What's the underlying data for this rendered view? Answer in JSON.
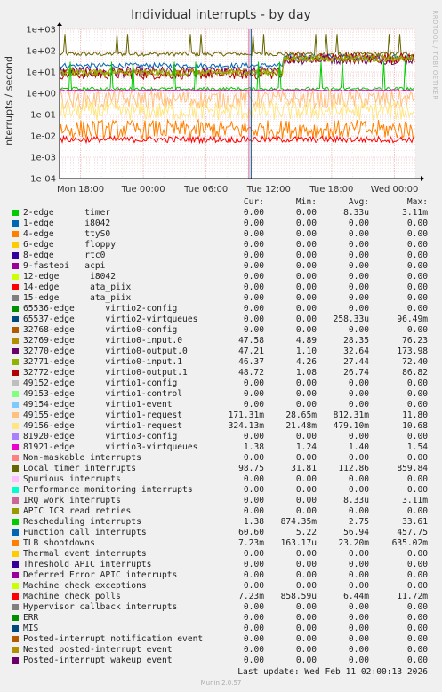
{
  "title": "Individual interrupts - by day",
  "ylabel": "interrupts / second",
  "side_label": "RRDTOOL / TOBI OETIKER",
  "columns": [
    "Cur:",
    "Min:",
    "Avg:",
    "Max:"
  ],
  "rows": [
    {
      "label": "2-edge      timer",
      "color": "#00cc00",
      "cur": "0.00",
      "min": "0.00",
      "avg": "8.33u",
      "max": "3.11m"
    },
    {
      "label": "1-edge      i8042",
      "color": "#0066b3",
      "cur": "0.00",
      "min": "0.00",
      "avg": "0.00",
      "max": "0.00"
    },
    {
      "label": "4-edge      ttyS0",
      "color": "#ff8000",
      "cur": "0.00",
      "min": "0.00",
      "avg": "0.00",
      "max": "0.00"
    },
    {
      "label": "6-edge      floppy",
      "color": "#ffcc00",
      "cur": "0.00",
      "min": "0.00",
      "avg": "0.00",
      "max": "0.00"
    },
    {
      "label": "8-edge      rtc0",
      "color": "#330099",
      "cur": "0.00",
      "min": "0.00",
      "avg": "0.00",
      "max": "0.00"
    },
    {
      "label": "9-fasteoi   acpi",
      "color": "#990099",
      "cur": "0.00",
      "min": "0.00",
      "avg": "0.00",
      "max": "0.00"
    },
    {
      "label": "12-edge      i8042",
      "color": "#ccff00",
      "cur": "0.00",
      "min": "0.00",
      "avg": "0.00",
      "max": "0.00"
    },
    {
      "label": "14-edge      ata_piix",
      "color": "#ff0000",
      "cur": "0.00",
      "min": "0.00",
      "avg": "0.00",
      "max": "0.00"
    },
    {
      "label": "15-edge      ata_piix",
      "color": "#808080",
      "cur": "0.00",
      "min": "0.00",
      "avg": "0.00",
      "max": "0.00"
    },
    {
      "label": "65536-edge      virtio2-config",
      "color": "#008f00",
      "cur": "0.00",
      "min": "0.00",
      "avg": "0.00",
      "max": "0.00"
    },
    {
      "label": "65537-edge      virtio2-virtqueues",
      "color": "#00487d",
      "cur": "0.00",
      "min": "0.00",
      "avg": "258.33u",
      "max": "96.49m"
    },
    {
      "label": "32768-edge      virtio0-config",
      "color": "#b35a00",
      "cur": "0.00",
      "min": "0.00",
      "avg": "0.00",
      "max": "0.00"
    },
    {
      "label": "32769-edge      virtio0-input.0",
      "color": "#b38f00",
      "cur": "47.58",
      "min": "4.89",
      "avg": "28.35",
      "max": "76.23"
    },
    {
      "label": "32770-edge      virtio0-output.0",
      "color": "#6b006b",
      "cur": "47.21",
      "min": "1.10",
      "avg": "32.64",
      "max": "173.98"
    },
    {
      "label": "32771-edge      virtio0-input.1",
      "color": "#8fb300",
      "cur": "46.37",
      "min": "4.26",
      "avg": "27.44",
      "max": "72.40"
    },
    {
      "label": "32772-edge      virtio0-output.1",
      "color": "#b30000",
      "cur": "48.72",
      "min": "1.08",
      "avg": "26.74",
      "max": "86.82"
    },
    {
      "label": "49152-edge      virtio1-config",
      "color": "#bebebe",
      "cur": "0.00",
      "min": "0.00",
      "avg": "0.00",
      "max": "0.00"
    },
    {
      "label": "49153-edge      virtio1-control",
      "color": "#80ff80",
      "cur": "0.00",
      "min": "0.00",
      "avg": "0.00",
      "max": "0.00"
    },
    {
      "label": "49154-edge      virtio1-event",
      "color": "#80c9ff",
      "cur": "0.00",
      "min": "0.00",
      "avg": "0.00",
      "max": "0.00"
    },
    {
      "label": "49155-edge      virtio1-request",
      "color": "#ffc080",
      "cur": "171.31m",
      "min": "28.65m",
      "avg": "812.31m",
      "max": "11.80"
    },
    {
      "label": "49156-edge      virtio1-request",
      "color": "#ffe680",
      "cur": "324.13m",
      "min": "21.48m",
      "avg": "479.10m",
      "max": "10.68"
    },
    {
      "label": "81920-edge      virtio3-config",
      "color": "#aa80ff",
      "cur": "0.00",
      "min": "0.00",
      "avg": "0.00",
      "max": "0.00"
    },
    {
      "label": "81921-edge      virtio3-virtqueues",
      "color": "#ee00cc",
      "cur": "1.38",
      "min": "1.24",
      "avg": "1.40",
      "max": "1.54"
    },
    {
      "label": "Non-maskable interrupts",
      "color": "#ff8080",
      "cur": "0.00",
      "min": "0.00",
      "avg": "0.00",
      "max": "0.00"
    },
    {
      "label": "Local timer interrupts",
      "color": "#666600",
      "cur": "98.75",
      "min": "31.81",
      "avg": "112.86",
      "max": "859.84"
    },
    {
      "label": "Spurious interrupts",
      "color": "#ffbfff",
      "cur": "0.00",
      "min": "0.00",
      "avg": "0.00",
      "max": "0.00"
    },
    {
      "label": "Performance monitoring interrupts",
      "color": "#00ffcc",
      "cur": "0.00",
      "min": "0.00",
      "avg": "0.00",
      "max": "0.00"
    },
    {
      "label": "IRQ work interrupts",
      "color": "#cc6699",
      "cur": "0.00",
      "min": "0.00",
      "avg": "8.33u",
      "max": "3.11m"
    },
    {
      "label": "APIC ICR read retries",
      "color": "#999900",
      "cur": "0.00",
      "min": "0.00",
      "avg": "0.00",
      "max": "0.00"
    },
    {
      "label": "Rescheduling interrupts",
      "color": "#00cc00",
      "cur": "1.38",
      "min": "874.35m",
      "avg": "2.75",
      "max": "33.61"
    },
    {
      "label": "Function call interrupts",
      "color": "#0066b3",
      "cur": "60.60",
      "min": "5.22",
      "avg": "56.94",
      "max": "457.75"
    },
    {
      "label": "TLB shootdowns",
      "color": "#ff8000",
      "cur": "7.23m",
      "min": "163.17u",
      "avg": "23.20m",
      "max": "635.02m"
    },
    {
      "label": "Thermal event interrupts",
      "color": "#ffcc00",
      "cur": "0.00",
      "min": "0.00",
      "avg": "0.00",
      "max": "0.00"
    },
    {
      "label": "Threshold APIC interrupts",
      "color": "#330099",
      "cur": "0.00",
      "min": "0.00",
      "avg": "0.00",
      "max": "0.00"
    },
    {
      "label": "Deferred Error APIC interrupts",
      "color": "#990099",
      "cur": "0.00",
      "min": "0.00",
      "avg": "0.00",
      "max": "0.00"
    },
    {
      "label": "Machine check exceptions",
      "color": "#ccff00",
      "cur": "0.00",
      "min": "0.00",
      "avg": "0.00",
      "max": "0.00"
    },
    {
      "label": "Machine check polls",
      "color": "#ff0000",
      "cur": "7.23m",
      "min": "858.59u",
      "avg": "6.44m",
      "max": "11.72m"
    },
    {
      "label": "Hypervisor callback interrupts",
      "color": "#808080",
      "cur": "0.00",
      "min": "0.00",
      "avg": "0.00",
      "max": "0.00"
    },
    {
      "label": "ERR",
      "color": "#008f00",
      "cur": "0.00",
      "min": "0.00",
      "avg": "0.00",
      "max": "0.00"
    },
    {
      "label": "MIS",
      "color": "#00487d",
      "cur": "0.00",
      "min": "0.00",
      "avg": "0.00",
      "max": "0.00"
    },
    {
      "label": "Posted-interrupt notification event",
      "color": "#b35a00",
      "cur": "0.00",
      "min": "0.00",
      "avg": "0.00",
      "max": "0.00"
    },
    {
      "label": "Nested posted-interrupt event",
      "color": "#b38f00",
      "cur": "0.00",
      "min": "0.00",
      "avg": "0.00",
      "max": "0.00"
    },
    {
      "label": "Posted-interrupt wakeup event",
      "color": "#6b006b",
      "cur": "0.00",
      "min": "0.00",
      "avg": "0.00",
      "max": "0.00"
    }
  ],
  "last_update": "Last update: Wed Feb 11 02:00:13 2026",
  "footer": "Munin 2.0.57",
  "chart_data": {
    "type": "line",
    "title": "Individual interrupts - by day",
    "ylabel": "interrupts / second",
    "yscale": "log",
    "ylim": [
      0.0001,
      1000
    ],
    "yticks": [
      "1e-04",
      "1e-03",
      "1e-02",
      "1e-01",
      "1e+00",
      "1e+01",
      "1e+02",
      "1e+03"
    ],
    "xticks": [
      "Mon 18:00",
      "Tue 00:00",
      "Tue 06:00",
      "Tue 12:00",
      "Tue 18:00",
      "Wed 00:00"
    ],
    "xlim_hours": [
      -2,
      32
    ],
    "grid": true,
    "series": [
      {
        "name": "Local timer interrupts",
        "color": "#666600",
        "base": 70,
        "spike": 600,
        "spike_every_h": 1,
        "noise": 0.1
      },
      {
        "name": "Function call interrupts",
        "color": "#0066b3",
        "base_before": 20,
        "base_after": 50,
        "switch_h": 19.4,
        "noise": 0.12
      },
      {
        "name": "32770-edge      virtio0-output.0",
        "color": "#6b006b",
        "base_before": 10,
        "base_after": 40,
        "switch_h": 19.4,
        "noise": 0.25
      },
      {
        "name": "32772-edge      virtio0-output.1",
        "color": "#b30000",
        "base_before": 8,
        "base_after": 45,
        "switch_h": 19.4,
        "noise": 0.25
      },
      {
        "name": "32769-edge      virtio0-input.0",
        "color": "#b38f00",
        "base_before": 10,
        "base_after": 45,
        "switch_h": 19.4,
        "noise": 0.15
      },
      {
        "name": "32771-edge      virtio0-input.1",
        "color": "#8fb300",
        "base_before": 9,
        "base_after": 42,
        "switch_h": 19.4,
        "noise": 0.15
      },
      {
        "name": "Rescheduling interrupts",
        "color": "#00cc00",
        "base": 1.6,
        "spike": 30,
        "spike_every_h": 2,
        "noise": 0.08
      },
      {
        "name": "81921-edge      virtio3-virtqueues",
        "color": "#ee00cc",
        "base": 1.4,
        "noise": 0.03
      },
      {
        "name": "49155-edge      virtio1-request",
        "color": "#ffc080",
        "base": 0.5,
        "noise": 0.45
      },
      {
        "name": "49156-edge      virtio1-request",
        "color": "#ffe680",
        "base": 0.15,
        "noise": 0.45
      },
      {
        "name": "TLB shootdowns",
        "color": "#ff8000",
        "base": 0.02,
        "noise": 0.45
      },
      {
        "name": "Machine check polls",
        "color": "#ff0000",
        "base": 0.0068,
        "noise": 0.15
      },
      {
        "name": "65537-edge      virtio2-virtqueues",
        "color": "#00487d",
        "base": 0,
        "drop_h": 16.3
      },
      {
        "name": "IRQ work interrupts",
        "color": "#cc6699",
        "base": 0,
        "drop_h": 16.1
      }
    ]
  }
}
